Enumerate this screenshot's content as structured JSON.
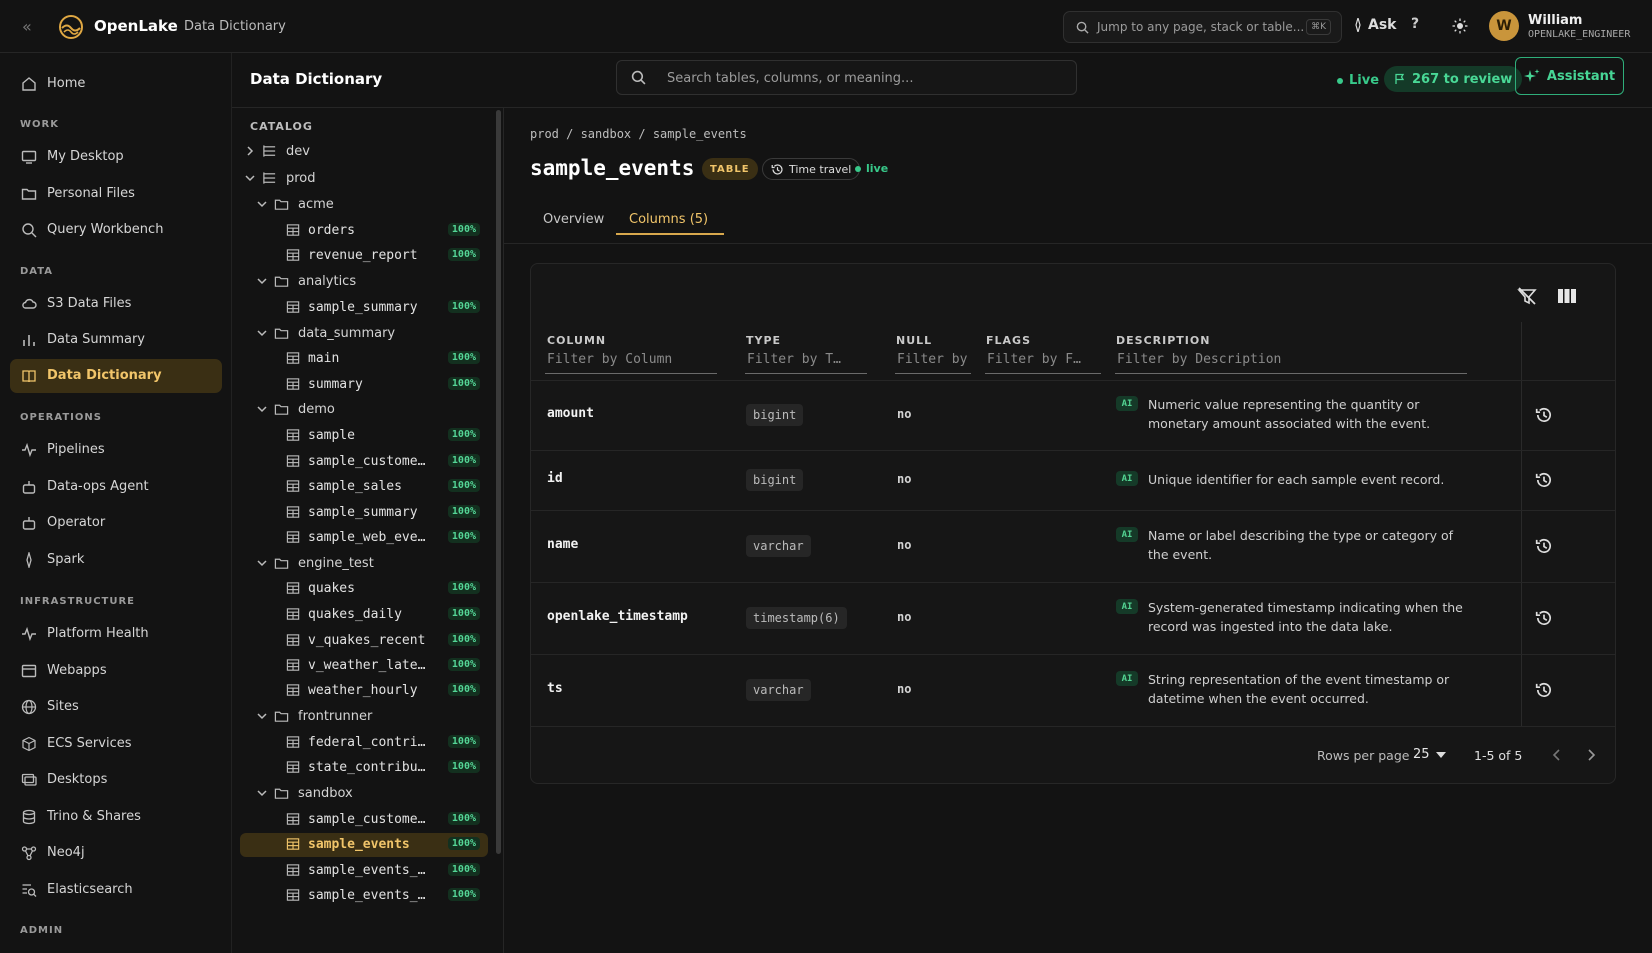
{
  "app": {
    "brand": "OpenLake",
    "breadcrumb": "Data Dictionary",
    "jump_placeholder": "Jump to any page, stack or table...",
    "jump_kbd": "⌘K",
    "ask_label": "Ask",
    "help_label": "?",
    "user": {
      "initial": "W",
      "name": "William",
      "role": "OPENLAKE_ENGINEER"
    }
  },
  "sidebar": {
    "home": "Home",
    "sections": {
      "work": "WORK",
      "data": "DATA",
      "operations": "OPERATIONS",
      "infrastructure": "INFRASTRUCTURE",
      "admin": "ADMIN"
    },
    "work": [
      "My Desktop",
      "Personal Files",
      "Query Workbench"
    ],
    "data": [
      "S3 Data Files",
      "Data Summary",
      "Data Dictionary"
    ],
    "operations": [
      "Pipelines",
      "Data-ops Agent",
      "Operator",
      "Spark"
    ],
    "infrastructure": [
      "Platform Health",
      "Webapps",
      "Sites",
      "ECS Services",
      "Desktops",
      "Trino & Shares",
      "Neo4j",
      "Elasticsearch"
    ]
  },
  "header": {
    "title": "Data Dictionary",
    "search_placeholder": "Search tables, columns, or meaning...",
    "live": "Live",
    "review": "267 to review",
    "assistant": "Assistant"
  },
  "catalog": {
    "label": "CATALOG",
    "items": [
      {
        "label": "dev"
      },
      {
        "label": "prod"
      },
      {
        "label": "acme"
      },
      {
        "label": "orders",
        "pct": "100%"
      },
      {
        "label": "revenue_report",
        "pct": "100%"
      },
      {
        "label": "analytics"
      },
      {
        "label": "sample_summary",
        "pct": "100%"
      },
      {
        "label": "data_summary"
      },
      {
        "label": "main",
        "pct": "100%"
      },
      {
        "label": "summary",
        "pct": "100%"
      },
      {
        "label": "demo"
      },
      {
        "label": "sample",
        "pct": "100%"
      },
      {
        "label": "sample_custome…",
        "pct": "100%"
      },
      {
        "label": "sample_sales",
        "pct": "100%"
      },
      {
        "label": "sample_summary",
        "pct": "100%"
      },
      {
        "label": "sample_web_eve…",
        "pct": "100%"
      },
      {
        "label": "engine_test"
      },
      {
        "label": "quakes",
        "pct": "100%"
      },
      {
        "label": "quakes_daily",
        "pct": "100%"
      },
      {
        "label": "v_quakes_recent",
        "pct": "100%"
      },
      {
        "label": "v_weather_late…",
        "pct": "100%"
      },
      {
        "label": "weather_hourly",
        "pct": "100%"
      },
      {
        "label": "frontrunner"
      },
      {
        "label": "federal_contri…",
        "pct": "100%"
      },
      {
        "label": "state_contribu…",
        "pct": "100%"
      },
      {
        "label": "sandbox"
      },
      {
        "label": "sample_custome…",
        "pct": "100%"
      },
      {
        "label": "sample_events",
        "pct": "100%"
      },
      {
        "label": "sample_events_…",
        "pct": "100%"
      },
      {
        "label": "sample_events_…",
        "pct": "100%"
      }
    ]
  },
  "table": {
    "path": "prod / sandbox / sample_events",
    "name": "sample_events",
    "badge_type": "TABLE",
    "badge_time_travel": "Time travel",
    "badge_live": "live",
    "tabs": [
      "Overview",
      "Columns (5)"
    ],
    "headers": {
      "column": "COLUMN",
      "type": "TYPE",
      "null": "NULL",
      "flags": "FLAGS",
      "description": "DESCRIPTION"
    },
    "filters": {
      "column": "Filter by Column",
      "type": "Filter by T…",
      "null": "Filter by …",
      "flags": "Filter by F…",
      "description": "Filter by Description"
    },
    "ai_label": "AI",
    "rows": [
      {
        "name": "amount",
        "type": "bigint",
        "null": "no",
        "desc": "Numeric value representing the quantity or monetary amount associated with the event."
      },
      {
        "name": "id",
        "type": "bigint",
        "null": "no",
        "desc": "Unique identifier for each sample event record."
      },
      {
        "name": "name",
        "type": "varchar",
        "null": "no",
        "desc": "Name or label describing the type or category of the event."
      },
      {
        "name": "openlake_timestamp",
        "type": "timestamp(6)",
        "null": "no",
        "desc": "System-generated timestamp indicating when the record was ingested into the data lake."
      },
      {
        "name": "ts",
        "type": "varchar",
        "null": "no",
        "desc": "String representation of the event timestamp or datetime when the event occurred."
      }
    ],
    "footer": {
      "rows_per_page_label": "Rows per page",
      "rows_per_page": "25",
      "range": "1-5 of 5"
    }
  }
}
